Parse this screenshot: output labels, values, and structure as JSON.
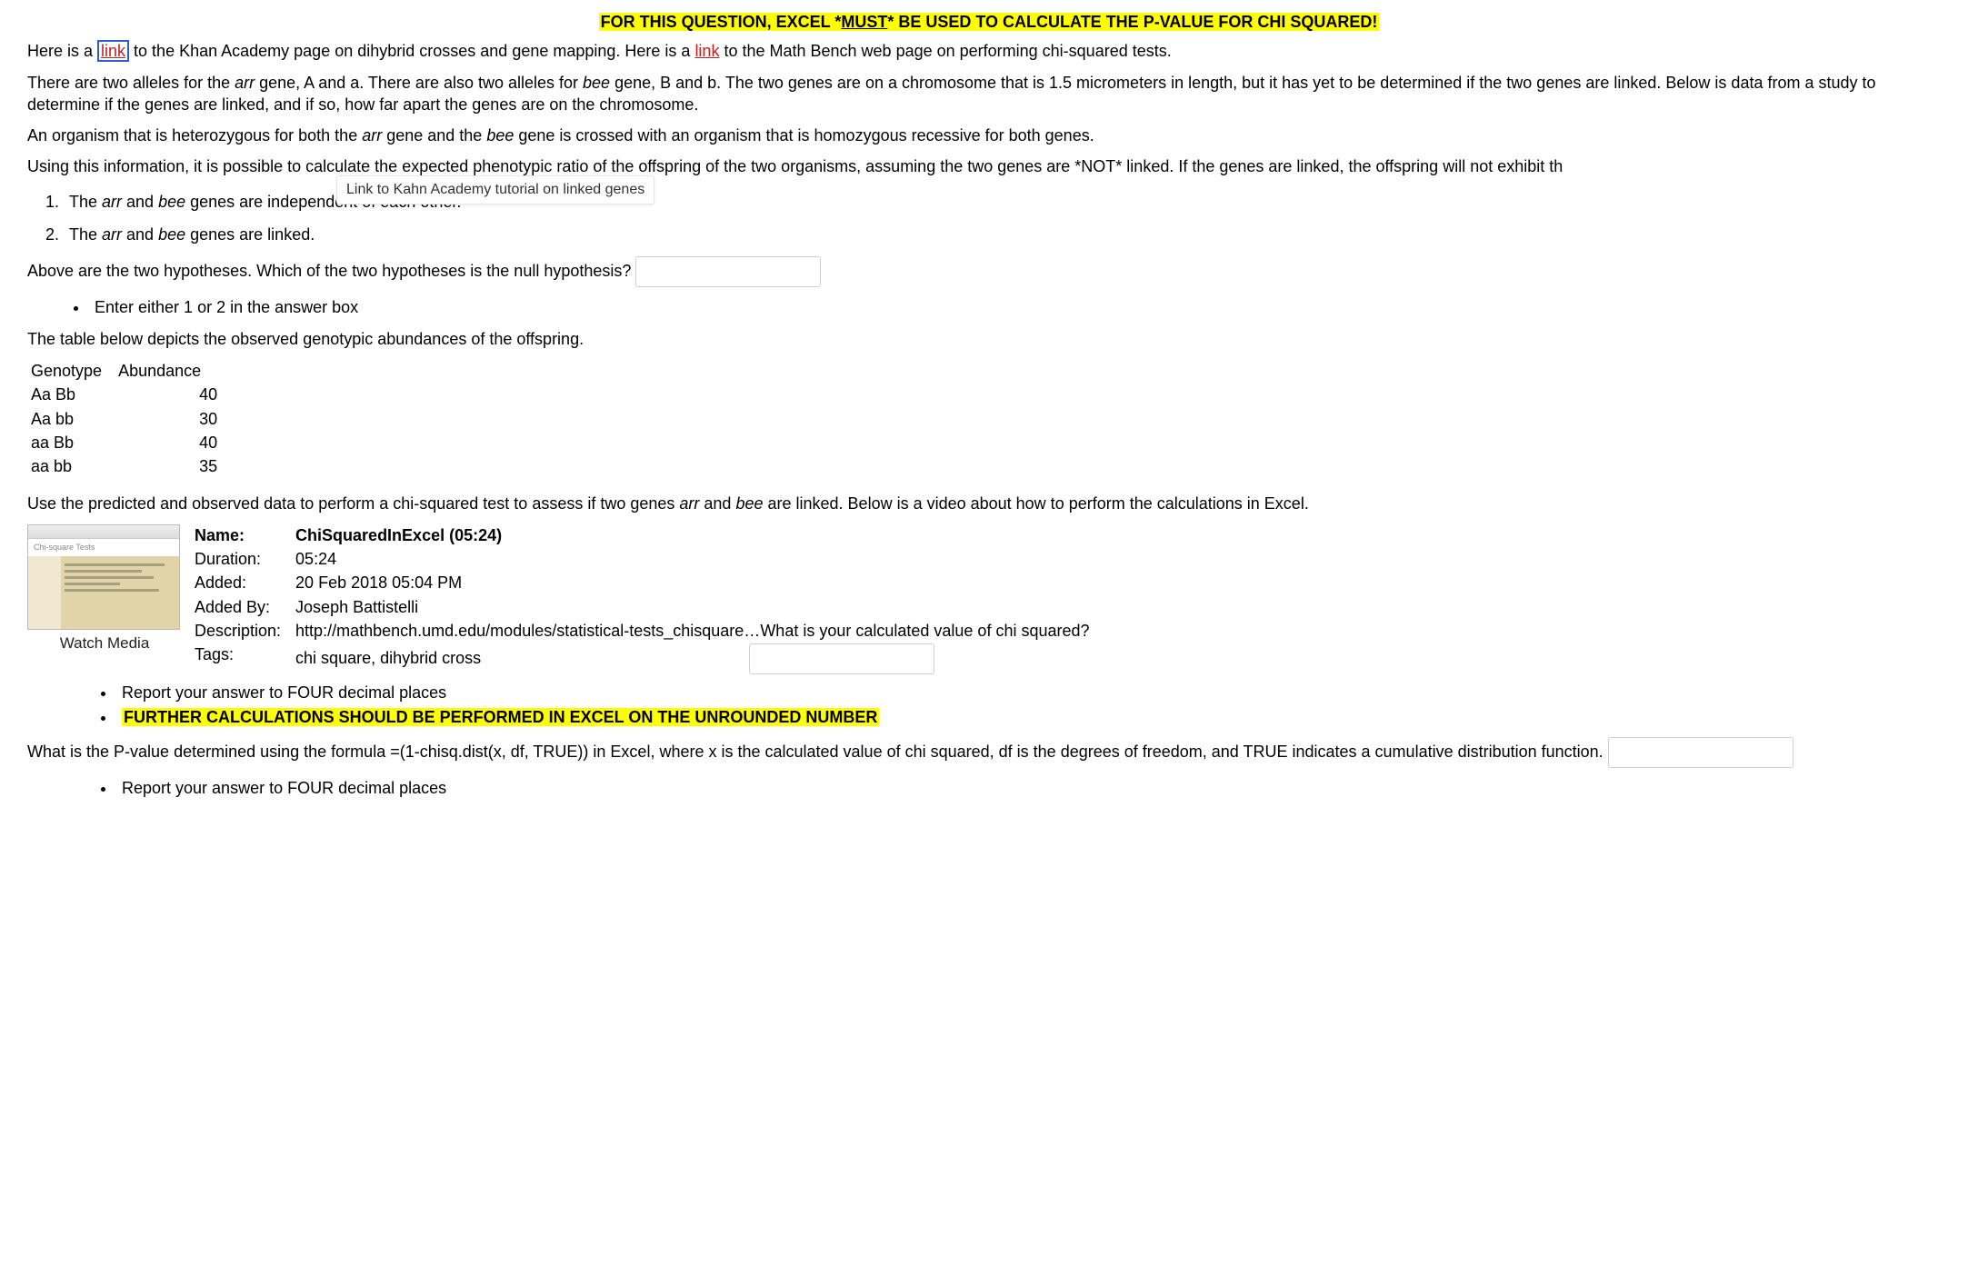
{
  "banner": {
    "pre": "FOR THIS QUESTION, EXCEL *",
    "must": "MUST",
    "post": "* BE USED TO CALCULATE THE P-VALUE FOR CHI SQUARED!"
  },
  "intro": {
    "p1_a": "Here is a ",
    "link1": "link",
    "p1_b": " to the Khan Academy page on dihybrid crosses and gene mapping. Here is a ",
    "link2": "link",
    "p1_c": " to the Math Bench web page on performing chi-squared tests."
  },
  "tooltip": "Link to Kahn Academy tutorial on linked genes",
  "p2_a": "There are two alleles for the ",
  "p2_arr": "arr",
  "p2_b": " gene, A and a. There are also two alleles for ",
  "p2_bee": "bee",
  "p2_c": " gene, B and b. The two genes are on a chromosome that is 1.5 micrometers in length, but it has yet to be determined if the two genes are linked. Below is data from a study to determine if the genes are linked, and if so, how far apart the genes are on the chromosome.",
  "p3_a": "An organism that is heterozygous for both the ",
  "p3_arr": "arr",
  "p3_b": " gene and the ",
  "p3_bee": "bee",
  "p3_c": " gene is crossed with an organism that is homozygous recessive for both genes.",
  "p4": "Using this information, it is possible to calculate the expected phenotypic ratio of the offspring of the two organisms, assuming the two genes are *NOT* linked. If the genes are linked, the offspring will not exhibit th",
  "hypotheses": {
    "h1_a": "The ",
    "h1_arr": "arr",
    "h1_b": " and ",
    "h1_bee": "bee",
    "h1_c": " genes are independent of each other.",
    "h2_a": "The ",
    "h2_arr": "arr",
    "h2_b": " and ",
    "h2_bee": "bee",
    "h2_c": " genes are linked."
  },
  "null_q": "Above are the two hypotheses. Which of the two hypotheses is the null hypothesis?",
  "null_hint": "Enter either 1 or 2 in the answer box",
  "table_intro": "The table below depicts the observed genotypic abundances of the offspring.",
  "table": {
    "h_geno": "Genotype",
    "h_abund": "Abundance",
    "rows": [
      {
        "g": "Aa Bb",
        "n": "40"
      },
      {
        "g": "Aa bb",
        "n": "30"
      },
      {
        "g": "aa Bb",
        "n": "40"
      },
      {
        "g": "aa bb",
        "n": "35"
      }
    ]
  },
  "chisq_intro_a": "Use the predicted and observed data to perform a chi-squared test to assess if two genes ",
  "chisq_intro_arr": "arr",
  "chisq_intro_b": " and ",
  "chisq_intro_bee": "bee",
  "chisq_intro_c": " are linked. Below is a video about how to perform the calculations in Excel.",
  "media": {
    "thumb_caption": "Chi-square Tests",
    "name_lbl": "Name:",
    "name_val": "ChiSquaredInExcel (05:24)",
    "dur_lbl": "Duration:",
    "dur_val": "05:24",
    "added_lbl": "Added:",
    "added_val": "20 Feb 2018 05:04 PM",
    "addedby_lbl": "Added By:",
    "addedby_val": "Joseph Battistelli",
    "desc_lbl": "Description:",
    "desc_val": "http://mathbench.umd.edu/modules/statistical-tests_chisquare…",
    "tags_lbl": "Tags:",
    "tags_val": "chi square, dihybrid cross",
    "watch": "Watch Media"
  },
  "q_chi": "What is your calculated value of chi squared?",
  "report4": "Report your answer to FOUR decimal places",
  "further": "FURTHER CALCULATIONS SHOULD BE PERFORMED IN EXCEL ON THE UNROUNDED NUMBER",
  "q_p": "What is the P-value determined using the formula =(1-chisq.dist(x, df, TRUE)) in Excel, where x is the calculated value of chi squared, df is the degrees of freedom, and TRUE indicates a cumulative distribution function.",
  "report4b": "Report your answer to FOUR decimal places"
}
